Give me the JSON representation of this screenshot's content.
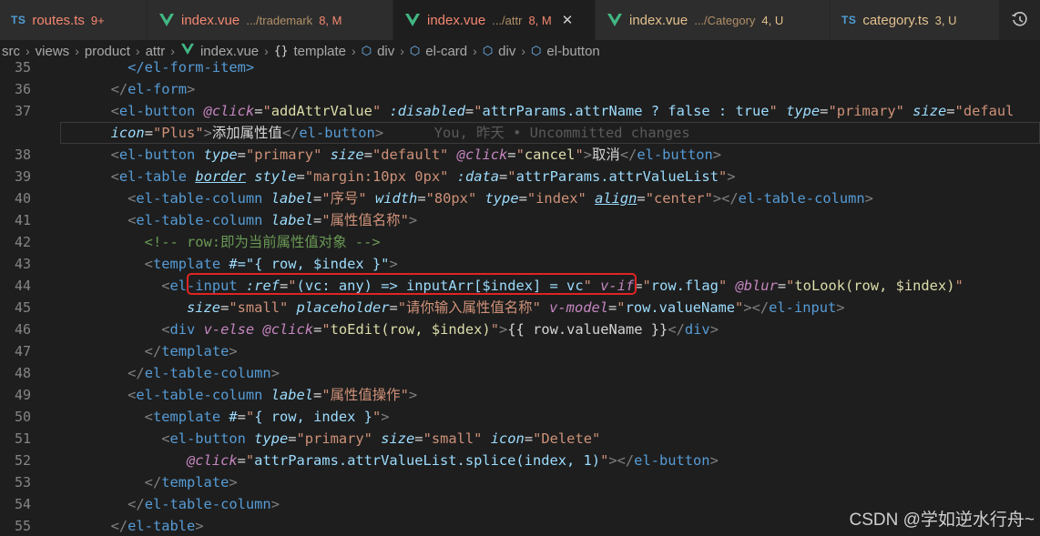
{
  "tabs": [
    {
      "icon": "ts",
      "name": "routes.ts",
      "dir": "",
      "badge": "9+",
      "active": false
    },
    {
      "icon": "vue",
      "name": "index.vue",
      "dir": ".../trademark",
      "badge": "8, M",
      "active": false
    },
    {
      "icon": "vue",
      "name": "index.vue",
      "dir": ".../attr",
      "badge": "8, M",
      "active": true
    },
    {
      "icon": "vue",
      "name": "index.vue",
      "dir": ".../Category",
      "badge": "4, U",
      "active": false
    },
    {
      "icon": "ts",
      "name": "category.ts",
      "dir": "",
      "badge": "3, U",
      "active": false
    }
  ],
  "tab_icon_label": "TS",
  "close_glyph": "✕",
  "breadcrumb": {
    "items": [
      "src",
      "views",
      "product",
      "attr"
    ],
    "file": "index.vue",
    "symbol": "template",
    "symbol_prefix": "{}",
    "elements": [
      "div",
      "el-card",
      "div",
      "el-button"
    ]
  },
  "line_numbers": [
    "35",
    "36",
    "37",
    "",
    "38",
    "39",
    "40",
    "41",
    "42",
    "43",
    "44",
    "45",
    "46",
    "47",
    "48",
    "49",
    "50",
    "51",
    "52",
    "53",
    "54",
    "55"
  ],
  "code": {
    "l35": "</el-form-item>",
    "l36_tag": "el-form",
    "l37_tag": "el-button",
    "l37_click_attr": "@click",
    "l37_click_val": "addAttrValue",
    "l37_disabled_attr": ":disabled",
    "l37_disabled_val": "attrParams.attrName ? false : true",
    "l37_type_attr": "type",
    "l37_type_val": "primary",
    "l37_size_attr": "size",
    "l37_size_val": "defaul",
    "l37b_icon_attr": "icon",
    "l37b_icon_val": "Plus",
    "l37b_text": "添加属性值",
    "l37b_blame": "You, 昨天 • Uncommitted changes",
    "l38_tag": "el-button",
    "l38_text": "取消",
    "l38_click_val": "cancel",
    "l39_tag": "el-table",
    "l39_style_val": "margin:10px 0px",
    "l39_data_val": "attrParams.attrValueList",
    "l40_tag": "el-table-column",
    "l40_label_val": "序号",
    "l40_width_val": "80px",
    "l40_type_val": "index",
    "l40_align_val": "center",
    "l41_label_val": "属性值名称",
    "l42_comment": "<!-- row:即为当前属性值对象 -->",
    "l43_tag": "template",
    "l43_slot": "#=\"{ row, $index }\"",
    "l44_tag": "el-input",
    "l44_ref_attr": ":ref",
    "l44_ref_val": "(vc: any) => inputArr[$index] = vc",
    "l44_vif_val": "row.flag",
    "l44_blur_val": "toLook(row, $index)",
    "l45_size_val": "small",
    "l45_placeholder_val": "请你输入属性值名称",
    "l45_vmodel_val": "row.valueName",
    "l46_click_val": "toEdit(row, $index)",
    "l46_text": "{{ row.valueName }}",
    "l49_label_val": "属性值操作",
    "l50_slot_val": "{ row, index }",
    "l51_icon_val": "Delete",
    "l52_click_val": "attrParams.attrValueList.splice(index, 1)"
  },
  "watermark": "CSDN @学如逆水行舟~",
  "colors": {
    "tag": "#569cd6",
    "attr": "#9cdcfe",
    "string": "#ce9178",
    "directive": "#c586c0",
    "highlight_border": "#e02424"
  }
}
